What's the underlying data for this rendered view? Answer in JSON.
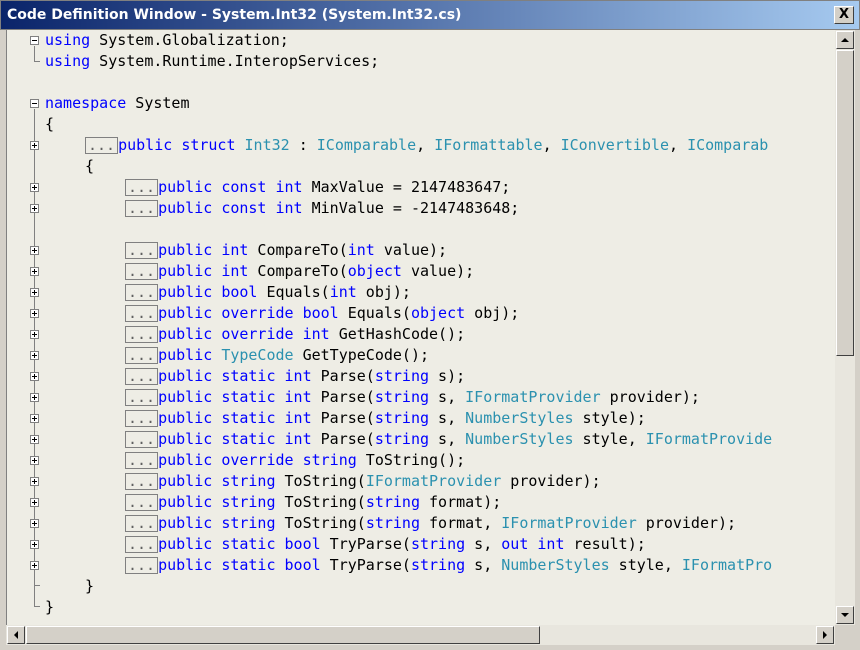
{
  "window": {
    "title": "Code Definition Window - System.Int32 (System.Int32.cs)",
    "close_label": "X"
  },
  "code": {
    "ellipsis": "...",
    "lines": [
      {
        "tokens": [
          {
            "k": "kw",
            "t": "using"
          },
          {
            "k": "p",
            "t": " System.Globalization;"
          }
        ]
      },
      {
        "tokens": [
          {
            "k": "kw",
            "t": "using"
          },
          {
            "k": "p",
            "t": " System.Runtime.InteropServices;"
          }
        ]
      },
      {
        "tokens": []
      },
      {
        "tokens": [
          {
            "k": "kw",
            "t": "namespace"
          },
          {
            "k": "p",
            "t": " System"
          }
        ]
      },
      {
        "tokens": [
          {
            "k": "p",
            "t": "{"
          }
        ]
      },
      {
        "collapsed": true,
        "tokens": [
          {
            "k": "kw",
            "t": "public"
          },
          {
            "k": "p",
            "t": " "
          },
          {
            "k": "kw",
            "t": "struct"
          },
          {
            "k": "p",
            "t": " "
          },
          {
            "k": "ty",
            "t": "Int32"
          },
          {
            "k": "p",
            "t": " : "
          },
          {
            "k": "ty",
            "t": "IComparable"
          },
          {
            "k": "p",
            "t": ", "
          },
          {
            "k": "ty",
            "t": "IFormattable"
          },
          {
            "k": "p",
            "t": ", "
          },
          {
            "k": "ty",
            "t": "IConvertible"
          },
          {
            "k": "p",
            "t": ", "
          },
          {
            "k": "ty",
            "t": "IComparab"
          }
        ]
      },
      {
        "tokens": [
          {
            "k": "p",
            "t": "{"
          }
        ]
      },
      {
        "collapsed": true,
        "tokens": [
          {
            "k": "kw",
            "t": "public"
          },
          {
            "k": "p",
            "t": " "
          },
          {
            "k": "kw",
            "t": "const"
          },
          {
            "k": "p",
            "t": " "
          },
          {
            "k": "kw",
            "t": "int"
          },
          {
            "k": "p",
            "t": " MaxValue = 2147483647;"
          }
        ]
      },
      {
        "collapsed": true,
        "tokens": [
          {
            "k": "kw",
            "t": "public"
          },
          {
            "k": "p",
            "t": " "
          },
          {
            "k": "kw",
            "t": "const"
          },
          {
            "k": "p",
            "t": " "
          },
          {
            "k": "kw",
            "t": "int"
          },
          {
            "k": "p",
            "t": " MinValue = -2147483648;"
          }
        ]
      },
      {
        "tokens": []
      },
      {
        "collapsed": true,
        "tokens": [
          {
            "k": "kw",
            "t": "public"
          },
          {
            "k": "p",
            "t": " "
          },
          {
            "k": "kw",
            "t": "int"
          },
          {
            "k": "p",
            "t": " CompareTo("
          },
          {
            "k": "kw",
            "t": "int"
          },
          {
            "k": "p",
            "t": " value);"
          }
        ]
      },
      {
        "collapsed": true,
        "tokens": [
          {
            "k": "kw",
            "t": "public"
          },
          {
            "k": "p",
            "t": " "
          },
          {
            "k": "kw",
            "t": "int"
          },
          {
            "k": "p",
            "t": " CompareTo("
          },
          {
            "k": "kw",
            "t": "object"
          },
          {
            "k": "p",
            "t": " value);"
          }
        ]
      },
      {
        "collapsed": true,
        "tokens": [
          {
            "k": "kw",
            "t": "public"
          },
          {
            "k": "p",
            "t": " "
          },
          {
            "k": "kw",
            "t": "bool"
          },
          {
            "k": "p",
            "t": " Equals("
          },
          {
            "k": "kw",
            "t": "int"
          },
          {
            "k": "p",
            "t": " obj);"
          }
        ]
      },
      {
        "collapsed": true,
        "tokens": [
          {
            "k": "kw",
            "t": "public"
          },
          {
            "k": "p",
            "t": " "
          },
          {
            "k": "kw",
            "t": "override"
          },
          {
            "k": "p",
            "t": " "
          },
          {
            "k": "kw",
            "t": "bool"
          },
          {
            "k": "p",
            "t": " Equals("
          },
          {
            "k": "kw",
            "t": "object"
          },
          {
            "k": "p",
            "t": " obj);"
          }
        ]
      },
      {
        "collapsed": true,
        "tokens": [
          {
            "k": "kw",
            "t": "public"
          },
          {
            "k": "p",
            "t": " "
          },
          {
            "k": "kw",
            "t": "override"
          },
          {
            "k": "p",
            "t": " "
          },
          {
            "k": "kw",
            "t": "int"
          },
          {
            "k": "p",
            "t": " GetHashCode();"
          }
        ]
      },
      {
        "collapsed": true,
        "tokens": [
          {
            "k": "kw",
            "t": "public"
          },
          {
            "k": "p",
            "t": " "
          },
          {
            "k": "ty",
            "t": "TypeCode"
          },
          {
            "k": "p",
            "t": " GetTypeCode();"
          }
        ]
      },
      {
        "collapsed": true,
        "tokens": [
          {
            "k": "kw",
            "t": "public"
          },
          {
            "k": "p",
            "t": " "
          },
          {
            "k": "kw",
            "t": "static"
          },
          {
            "k": "p",
            "t": " "
          },
          {
            "k": "kw",
            "t": "int"
          },
          {
            "k": "p",
            "t": " Parse("
          },
          {
            "k": "kw",
            "t": "string"
          },
          {
            "k": "p",
            "t": " s);"
          }
        ]
      },
      {
        "collapsed": true,
        "tokens": [
          {
            "k": "kw",
            "t": "public"
          },
          {
            "k": "p",
            "t": " "
          },
          {
            "k": "kw",
            "t": "static"
          },
          {
            "k": "p",
            "t": " "
          },
          {
            "k": "kw",
            "t": "int"
          },
          {
            "k": "p",
            "t": " Parse("
          },
          {
            "k": "kw",
            "t": "string"
          },
          {
            "k": "p",
            "t": " s, "
          },
          {
            "k": "ty",
            "t": "IFormatProvider"
          },
          {
            "k": "p",
            "t": " provider);"
          }
        ]
      },
      {
        "collapsed": true,
        "tokens": [
          {
            "k": "kw",
            "t": "public"
          },
          {
            "k": "p",
            "t": " "
          },
          {
            "k": "kw",
            "t": "static"
          },
          {
            "k": "p",
            "t": " "
          },
          {
            "k": "kw",
            "t": "int"
          },
          {
            "k": "p",
            "t": " Parse("
          },
          {
            "k": "kw",
            "t": "string"
          },
          {
            "k": "p",
            "t": " s, "
          },
          {
            "k": "ty",
            "t": "NumberStyles"
          },
          {
            "k": "p",
            "t": " style);"
          }
        ]
      },
      {
        "collapsed": true,
        "tokens": [
          {
            "k": "kw",
            "t": "public"
          },
          {
            "k": "p",
            "t": " "
          },
          {
            "k": "kw",
            "t": "static"
          },
          {
            "k": "p",
            "t": " "
          },
          {
            "k": "kw",
            "t": "int"
          },
          {
            "k": "p",
            "t": " Parse("
          },
          {
            "k": "kw",
            "t": "string"
          },
          {
            "k": "p",
            "t": " s, "
          },
          {
            "k": "ty",
            "t": "NumberStyles"
          },
          {
            "k": "p",
            "t": " style, "
          },
          {
            "k": "ty",
            "t": "IFormatProvide"
          }
        ]
      },
      {
        "collapsed": true,
        "tokens": [
          {
            "k": "kw",
            "t": "public"
          },
          {
            "k": "p",
            "t": " "
          },
          {
            "k": "kw",
            "t": "override"
          },
          {
            "k": "p",
            "t": " "
          },
          {
            "k": "kw",
            "t": "string"
          },
          {
            "k": "p",
            "t": " ToString();"
          }
        ]
      },
      {
        "collapsed": true,
        "tokens": [
          {
            "k": "kw",
            "t": "public"
          },
          {
            "k": "p",
            "t": " "
          },
          {
            "k": "kw",
            "t": "string"
          },
          {
            "k": "p",
            "t": " ToString("
          },
          {
            "k": "ty",
            "t": "IFormatProvider"
          },
          {
            "k": "p",
            "t": " provider);"
          }
        ]
      },
      {
        "collapsed": true,
        "tokens": [
          {
            "k": "kw",
            "t": "public"
          },
          {
            "k": "p",
            "t": " "
          },
          {
            "k": "kw",
            "t": "string"
          },
          {
            "k": "p",
            "t": " ToString("
          },
          {
            "k": "kw",
            "t": "string"
          },
          {
            "k": "p",
            "t": " format);"
          }
        ]
      },
      {
        "collapsed": true,
        "tokens": [
          {
            "k": "kw",
            "t": "public"
          },
          {
            "k": "p",
            "t": " "
          },
          {
            "k": "kw",
            "t": "string"
          },
          {
            "k": "p",
            "t": " ToString("
          },
          {
            "k": "kw",
            "t": "string"
          },
          {
            "k": "p",
            "t": " format, "
          },
          {
            "k": "ty",
            "t": "IFormatProvider"
          },
          {
            "k": "p",
            "t": " provider);"
          }
        ]
      },
      {
        "collapsed": true,
        "tokens": [
          {
            "k": "kw",
            "t": "public"
          },
          {
            "k": "p",
            "t": " "
          },
          {
            "k": "kw",
            "t": "static"
          },
          {
            "k": "p",
            "t": " "
          },
          {
            "k": "kw",
            "t": "bool"
          },
          {
            "k": "p",
            "t": " TryParse("
          },
          {
            "k": "kw",
            "t": "string"
          },
          {
            "k": "p",
            "t": " s, "
          },
          {
            "k": "kw",
            "t": "out"
          },
          {
            "k": "p",
            "t": " "
          },
          {
            "k": "kw",
            "t": "int"
          },
          {
            "k": "p",
            "t": " result);"
          }
        ]
      },
      {
        "collapsed": true,
        "tokens": [
          {
            "k": "kw",
            "t": "public"
          },
          {
            "k": "p",
            "t": " "
          },
          {
            "k": "kw",
            "t": "static"
          },
          {
            "k": "p",
            "t": " "
          },
          {
            "k": "kw",
            "t": "bool"
          },
          {
            "k": "p",
            "t": " TryParse("
          },
          {
            "k": "kw",
            "t": "string"
          },
          {
            "k": "p",
            "t": " s, "
          },
          {
            "k": "ty",
            "t": "NumberStyles"
          },
          {
            "k": "p",
            "t": " style, "
          },
          {
            "k": "ty",
            "t": "IFormatPro"
          }
        ]
      },
      {
        "tokens": [
          {
            "k": "p",
            "t": "}"
          }
        ]
      },
      {
        "tokens": [
          {
            "k": "p",
            "t": "}"
          }
        ]
      }
    ]
  },
  "colors": {
    "keyword": "#0000ff",
    "type": "#2b91af",
    "editor_bg": "#eeede5"
  }
}
